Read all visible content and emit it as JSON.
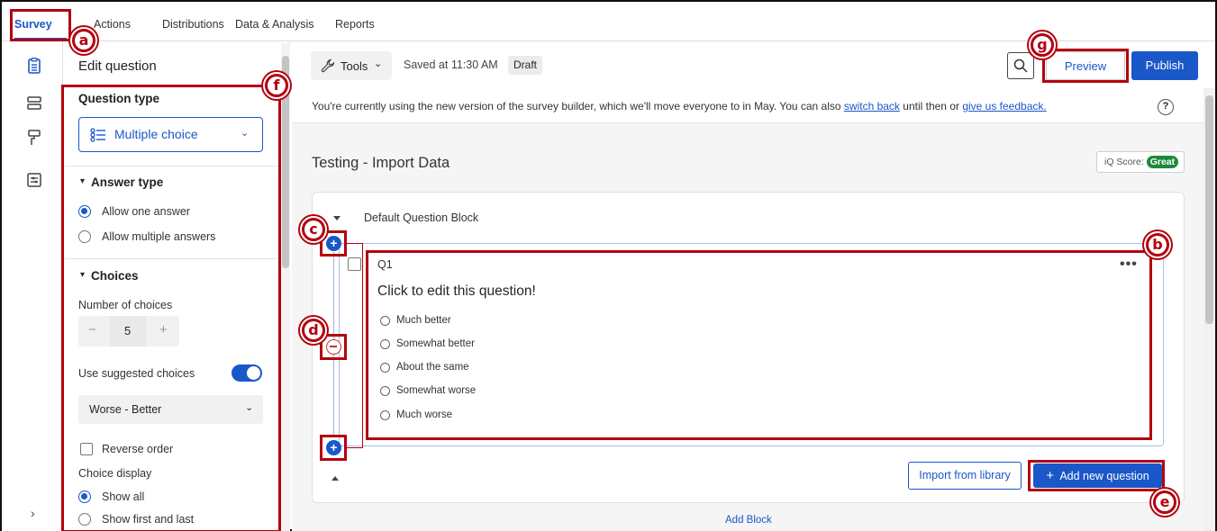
{
  "nav": {
    "tabs": [
      "Survey",
      "Actions",
      "Distributions",
      "Data & Analysis",
      "Reports"
    ]
  },
  "panel": {
    "title": "Edit question",
    "question_type_title": "Question type",
    "question_type_value": "Multiple choice",
    "answer_type_title": "Answer type",
    "answer_type_options": [
      "Allow one answer",
      "Allow multiple answers"
    ],
    "choices_title": "Choices",
    "number_of_choices_label": "Number of choices",
    "number_of_choices_value": "5",
    "use_suggested_label": "Use suggested choices",
    "suggested_value": "Worse - Better",
    "reverse_order_label": "Reverse order",
    "choice_display_label": "Choice display",
    "choice_display_options": [
      "Show all",
      "Show first and last"
    ]
  },
  "toolbar": {
    "tools_label": "Tools",
    "saved_text": "Saved at 11:30 AM",
    "draft_label": "Draft",
    "preview_label": "Preview",
    "publish_label": "Publish"
  },
  "banner": {
    "text_before": "You're currently using the new version of the survey builder, which we'll move everyone to in May. You can also ",
    "switch_back": "switch back",
    "text_middle": " until then or ",
    "feedback": "give us feedback.",
    "help": "?"
  },
  "survey": {
    "title": "Testing - Import Data",
    "iq_score_label": "iQ Score:",
    "iq_score_value": "Great"
  },
  "block": {
    "title": "Default Question Block",
    "question_label": "Q1",
    "question_text": "Click to edit this question!",
    "menu": "•••",
    "choices": [
      "Much better",
      "Somewhat better",
      "About the same",
      "Somewhat worse",
      "Much worse"
    ],
    "import_label": "Import from library",
    "add_question_label": "Add new question",
    "add_block_label": "Add Block"
  },
  "annotations": {
    "markers": [
      "a",
      "b",
      "c",
      "d",
      "e",
      "f",
      "g"
    ],
    "color": "#b3000f"
  },
  "colors": {
    "accent": "#1a57c8",
    "success": "#1d8a3a"
  }
}
